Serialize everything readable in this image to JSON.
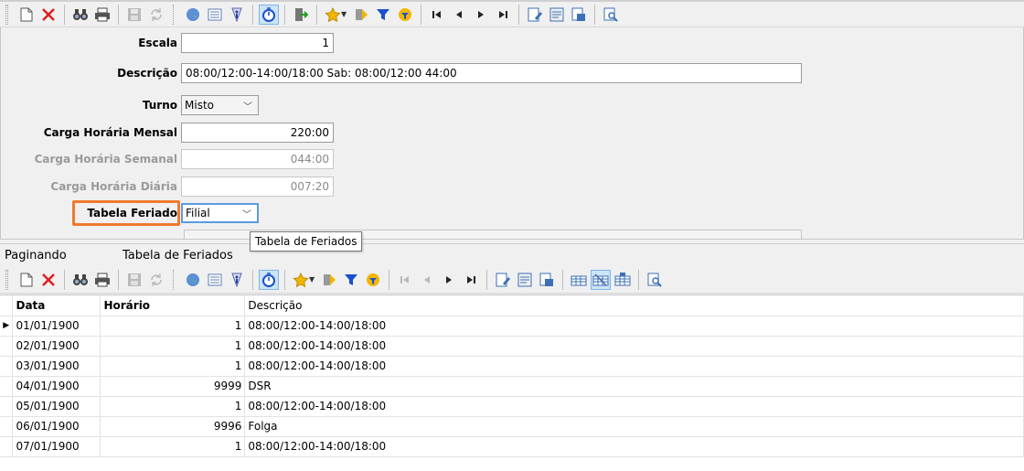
{
  "form": {
    "escala": {
      "label": "Escala",
      "value": "1"
    },
    "descricao": {
      "label": "Descrição",
      "value": "08:00/12:00-14:00/18:00 Sab: 08:00/12:00 44:00"
    },
    "turno": {
      "label": "Turno",
      "value": "Misto"
    },
    "carga_mensal": {
      "label": "Carga Horária Mensal",
      "value": "220:00"
    },
    "carga_semanal": {
      "label": "Carga Horária Semanal",
      "value": "044:00"
    },
    "carga_diaria": {
      "label": "Carga Horária Diária",
      "value": "007:20"
    },
    "tabela_feriado": {
      "label": "Tabela Feriado",
      "value": "Filial"
    }
  },
  "tooltip": "Tabela de Feriados",
  "tabs": [
    "Paginando",
    "Tabela de Feriados"
  ],
  "grid": {
    "columns": [
      "Data",
      "Horário",
      "Descrição"
    ],
    "rows": [
      {
        "data": "01/01/1900",
        "horario": "1",
        "descricao": "08:00/12:00-14:00/18:00"
      },
      {
        "data": "02/01/1900",
        "horario": "1",
        "descricao": "08:00/12:00-14:00/18:00"
      },
      {
        "data": "03/01/1900",
        "horario": "1",
        "descricao": "08:00/12:00-14:00/18:00"
      },
      {
        "data": "04/01/1900",
        "horario": "9999",
        "descricao": "DSR"
      },
      {
        "data": "05/01/1900",
        "horario": "1",
        "descricao": "08:00/12:00-14:00/18:00"
      },
      {
        "data": "06/01/1900",
        "horario": "9996",
        "descricao": "Folga"
      },
      {
        "data": "07/01/1900",
        "horario": "1",
        "descricao": "08:00/12:00-14:00/18:00"
      }
    ]
  },
  "colors": {
    "highlight": "#f07a2e",
    "focus": "#5a9be0",
    "delete_red": "#e02020",
    "filter_blue": "#1a4fcf",
    "star": "#f2b600"
  },
  "icons": {
    "toolbar_top": [
      "new-doc-icon",
      "delete-icon",
      "binoculars-icon",
      "printer-icon",
      "save-disk-icon",
      "refresh-icon",
      "globe-icon",
      "list-icon",
      "info-icon",
      "stopwatch-icon",
      "exit-icon",
      "star-icon",
      "goto-icon",
      "filter-icon",
      "clear-filter-icon",
      "first-icon",
      "prev-icon",
      "next-icon",
      "last-icon",
      "edit-form-icon",
      "report-icon",
      "export-icon",
      "print-preview-icon"
    ],
    "toolbar_bottom_extra": [
      "grid-insert-icon",
      "grid-edit-icon",
      "grid-delete-icon"
    ]
  }
}
